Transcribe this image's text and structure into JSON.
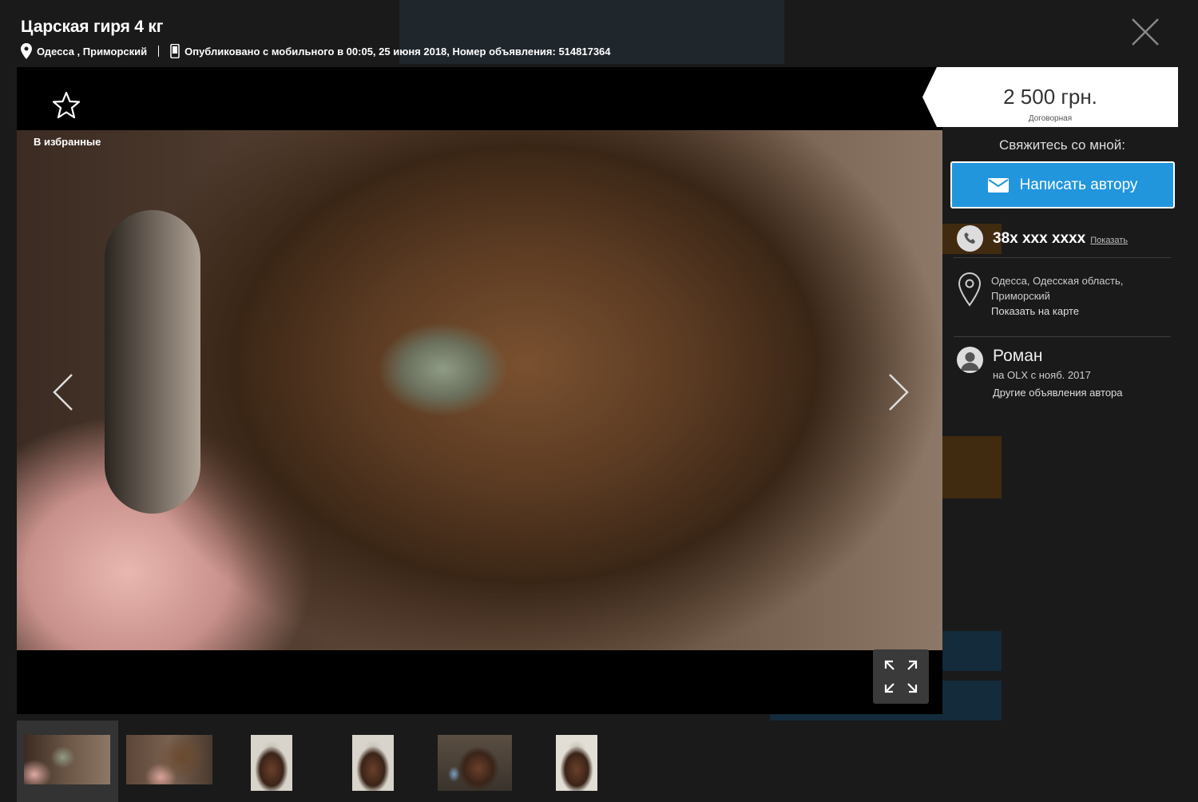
{
  "listing": {
    "title": "Царская гиря 4 кг",
    "location_short": "Одесса , Приморский",
    "published": "Опубликовано с мобильного в 00:05, 25 июня 2018, Номер объявления: 514817364"
  },
  "viewer": {
    "favorite_label": "В избранные"
  },
  "price": {
    "amount": "2 500 грн.",
    "note": "Договорная"
  },
  "contact": {
    "title": "Свяжитесь со мной:",
    "message_label": "Написать автору",
    "phone": "38x xxx xxxx",
    "phone_show": "Показать"
  },
  "location": {
    "address": "Одесса, Одесская область, Приморский",
    "map_link": "Показать на карте"
  },
  "user": {
    "name": "Роман",
    "since": "на OLX с нояб. 2017",
    "other_ads": "Другие объявления автора"
  },
  "colors": {
    "accent": "#2196dd",
    "overlay_bg": "#1a1a1a"
  },
  "thumbnails": [
    "photo-1",
    "photo-2",
    "photo-3",
    "photo-4",
    "photo-5",
    "photo-6"
  ]
}
